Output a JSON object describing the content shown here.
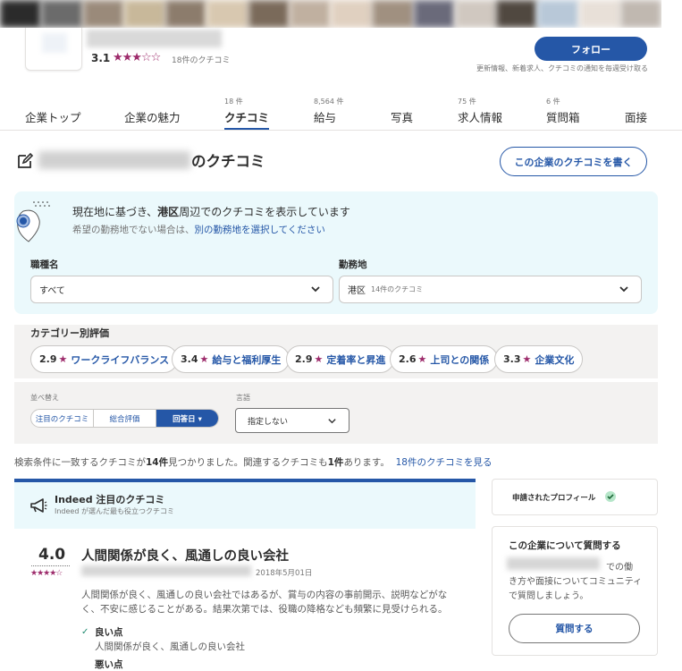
{
  "header": {
    "rating_value": "3.1",
    "rating_stars": "★★★☆☆",
    "review_count": "18件のクチコミ",
    "follow_label": "フォロー",
    "follow_note": "更新情報、新着求人、クチコミの通知を毎週受け取る"
  },
  "tabs": [
    {
      "count": "",
      "label": "企業トップ"
    },
    {
      "count": "",
      "label": "企業の魅力"
    },
    {
      "count": "18 件",
      "label": "クチコミ"
    },
    {
      "count": "8,564 件",
      "label": "給与"
    },
    {
      "count": "",
      "label": "写真"
    },
    {
      "count": "75 件",
      "label": "求人情報"
    },
    {
      "count": "6 件",
      "label": "質問箱"
    },
    {
      "count": "",
      "label": "面接"
    }
  ],
  "page": {
    "title_suffix": "のクチコミ",
    "write_review_label": "この企業のクチコミを書く"
  },
  "location": {
    "heading_prefix": "現在地に基づき、",
    "heading_place": "港区",
    "heading_suffix": "周辺でのクチコミを表示しています",
    "sub_prefix": "希望の勤務地でない場合は、",
    "sub_link": "別の勤務地を選択してください"
  },
  "filters": {
    "job_label": "職種名",
    "job_value": "すべて",
    "area_label": "勤務地",
    "area_value": "港区",
    "area_count": "14件のクチコミ"
  },
  "categories": {
    "heading": "カテゴリー別評価",
    "items": [
      {
        "score": "2.9",
        "label": "ワークライフバランス"
      },
      {
        "score": "3.4",
        "label": "給与と福利厚生"
      },
      {
        "score": "2.9",
        "label": "定着率と昇進"
      },
      {
        "score": "2.6",
        "label": "上司との関係"
      },
      {
        "score": "3.3",
        "label": "企業文化"
      }
    ]
  },
  "sort": {
    "heading": "並べ替え",
    "options": [
      "注目のクチコミ",
      "総合評価",
      "回答日 ▾"
    ],
    "lang_heading": "言語",
    "lang_value": "指定しない"
  },
  "results": {
    "text_a": "検索条件に一致するクチコミが",
    "count": "14件",
    "text_b": "見つかりました。関連するクチコミも",
    "related": "1件",
    "text_c": "あります。",
    "link": "18件のクチコミを見る"
  },
  "featured": {
    "title": "Indeed 注目のクチコミ",
    "subtitle": "Indeed が選んだ最も役立つクチコミ"
  },
  "review": {
    "rating": "4.0",
    "stars": "★★★★☆",
    "title": "人間関係が良く、風通しの良い会社",
    "date": "2018年5月01日",
    "body": "人間関係が良く、風通しの良い会社ではあるが、賞与の内容の事前開示、説明などがなく、不安に感じることがある。結果次第では、役職の降格なども頻繁に見受けられる。",
    "pros_label": "良い点",
    "pros_text": "人間関係が良く、風通しの良い会社",
    "cons_label": "悪い点"
  },
  "sidebar": {
    "claimed_label": "申請されたプロフィール",
    "ask_title": "この企業について質問する",
    "ask_desc_1": "での働",
    "ask_desc_2": "き方や面接についてコミュニティで質問しましょう。",
    "ask_button": "質問する"
  },
  "colors": {
    "brand_blue": "#2557a7",
    "star_magenta": "#9d2b6b",
    "panel_cyan": "#ebf9fc",
    "panel_gray": "#f3f2f1"
  }
}
